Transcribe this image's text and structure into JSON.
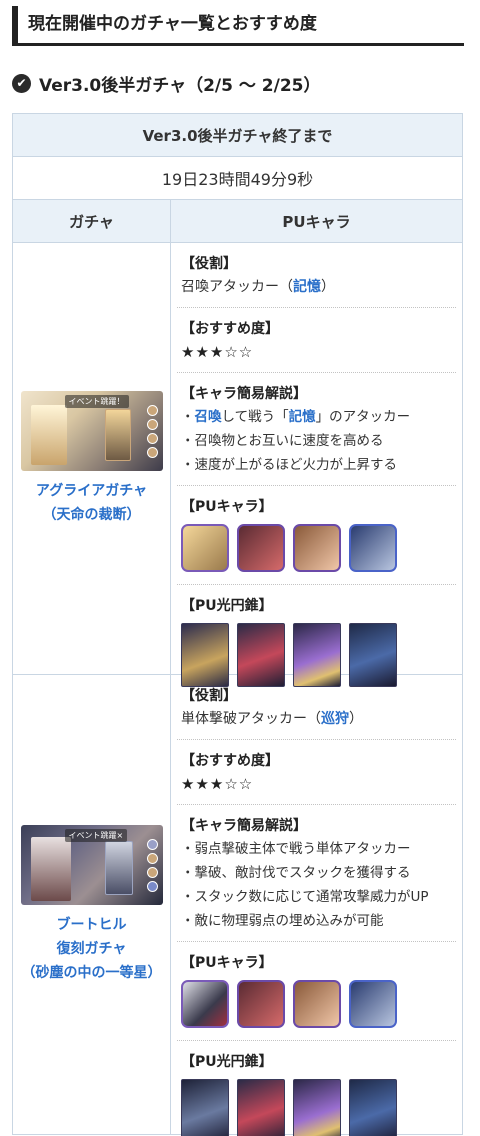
{
  "heading": "現在開催中のガチャ一覧とおすすめ度",
  "subheading": "Ver3.0後半ガチャ（2/5 〜 2/25）",
  "table": {
    "end_label": "Ver3.0後半ガチャ終了まで",
    "timer": "19日23時間49分9秒",
    "col_gacha": "ガチャ",
    "col_pu": "PUキャラ"
  },
  "gachas": [
    {
      "banner_label": "イベント跳躍！",
      "name_lines": [
        "アグライアガチャ",
        "（天命の裁断）"
      ],
      "role_title": "【役割】",
      "role_prefix": "召喚アタッカー（",
      "role_path": "記憶",
      "role_suffix": "）",
      "rec_title": "【おすすめ度】",
      "stars": "★★★☆☆",
      "desc_title": "【キャラ簡易解説】",
      "desc": [
        {
          "pre": "・",
          "b1": "召喚",
          "mid": "して戦う「",
          "b2": "記憶",
          "post": "」のアタッカー"
        },
        {
          "pre": "・召喚物とお互いに速度を高める"
        },
        {
          "pre": "・速度が上がるほど火力が上昇する"
        }
      ],
      "pu_char_title": "【PUキャラ】",
      "pu_lc_title": "【PU光円錐】",
      "icons": [
        "character-icon-aglaea",
        "character-icon-sparkle",
        "character-icon-hanya",
        "character-icon-lynx"
      ],
      "cones": [
        "light-cone-aglaea",
        "light-cone-red",
        "light-cone-purple",
        "light-cone-dark"
      ]
    },
    {
      "banner_label": "イベント跳躍×",
      "name_lines": [
        "ブートヒル",
        "復刻ガチャ",
        "（砂塵の中の一等星）"
      ],
      "role_title": "【役割】",
      "role_prefix": "単体撃破アタッカー（",
      "role_path": "巡狩",
      "role_suffix": "）",
      "rec_title": "【おすすめ度】",
      "stars": "★★★☆☆",
      "desc_title": "【キャラ簡易解説】",
      "desc": [
        {
          "pre": "・弱点撃破主体で戦う単体アタッカー"
        },
        {
          "pre": "・撃破、敵討伐でスタックを獲得する"
        },
        {
          "pre": "・スタック数に応じて通常攻撃威力がUP"
        },
        {
          "pre": "・敵に物理弱点の埋め込みが可能"
        }
      ],
      "pu_char_title": "【PUキャラ】",
      "pu_lc_title": "【PU光円錐】",
      "icons": [
        "character-icon-boothill",
        "character-icon-sparkle",
        "character-icon-hanya",
        "character-icon-lynx"
      ],
      "cones": [
        "light-cone-boothill",
        "light-cone-red",
        "light-cone-purple",
        "light-cone-dark"
      ]
    }
  ],
  "colors": {
    "link": "#2a6fc9",
    "table_border": "#c9d6e3",
    "header_bg": "#e9f1f8"
  }
}
